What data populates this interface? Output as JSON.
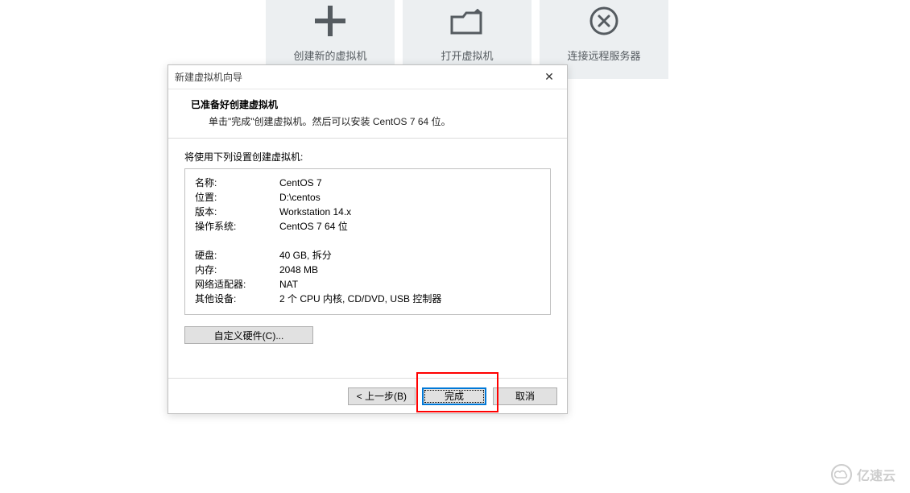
{
  "tiles": {
    "create": "创建新的虚拟机",
    "open": "打开虚拟机",
    "connect": "连接远程服务器"
  },
  "dialog": {
    "title": "新建虚拟机向导",
    "header_title": "已准备好创建虚拟机",
    "header_sub": "单击\"完成\"创建虚拟机。然后可以安装 CentOS 7 64 位。",
    "settings_label": "将使用下列设置创建虚拟机:",
    "rows": {
      "name_k": "名称:",
      "name_v": "CentOS 7",
      "loc_k": "位置:",
      "loc_v": "D:\\centos",
      "ver_k": "版本:",
      "ver_v": "Workstation 14.x",
      "os_k": "操作系统:",
      "os_v": "CentOS 7 64 位",
      "disk_k": "硬盘:",
      "disk_v": "40 GB, 拆分",
      "mem_k": "内存:",
      "mem_v": "2048 MB",
      "net_k": "网络适配器:",
      "net_v": "NAT",
      "dev_k": "其他设备:",
      "dev_v": "2 个 CPU 内核, CD/DVD, USB 控制器"
    },
    "custom_hw": "自定义硬件(C)...",
    "back": "< 上一步(B)",
    "finish": "完成",
    "cancel": "取消"
  },
  "watermark": "亿速云"
}
